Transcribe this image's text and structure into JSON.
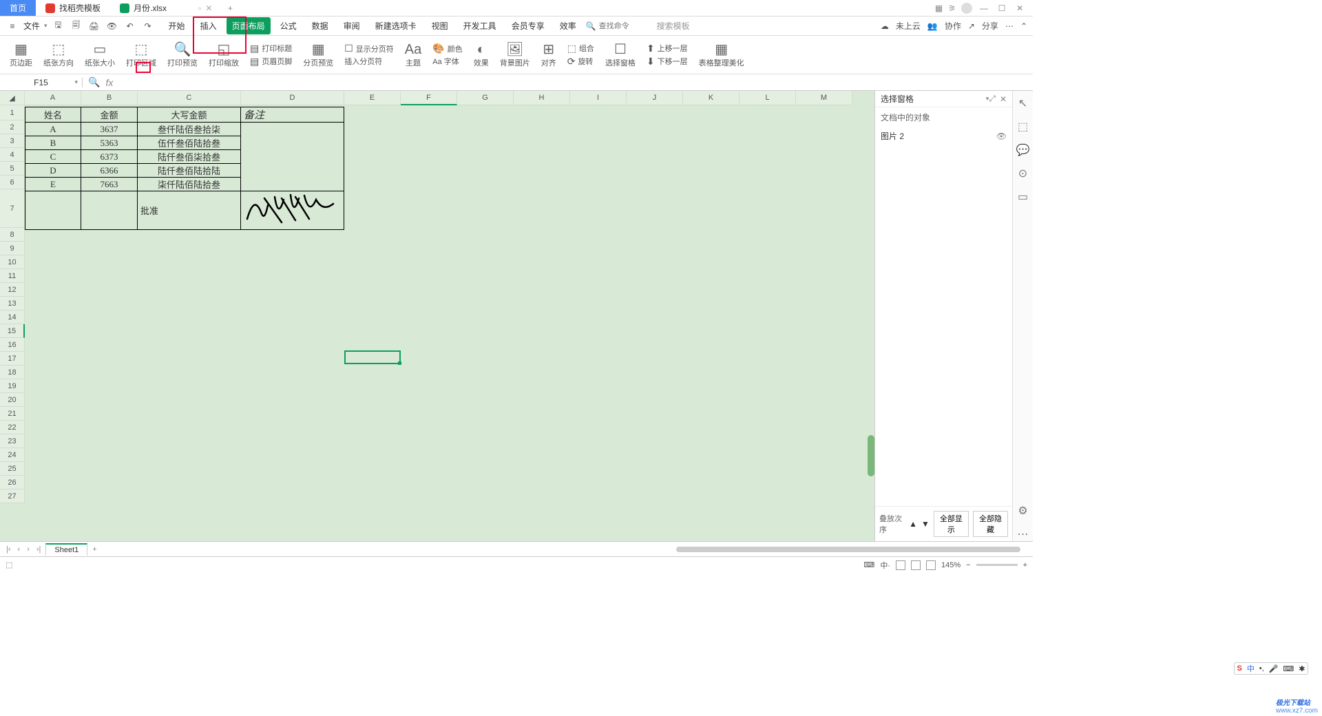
{
  "title_tabs": {
    "home": "首页",
    "templates": "找稻壳模板",
    "current_doc": "月份.xlsx",
    "plus": "+"
  },
  "window_controls": {
    "min": "—",
    "max": "☐",
    "close": "✕"
  },
  "file_menu": "文件",
  "menu": {
    "items": [
      "开始",
      "插入",
      "页面布局",
      "公式",
      "数据",
      "审阅",
      "新建选项卡",
      "视图",
      "开发工具",
      "会员专享",
      "效率"
    ],
    "active": "页面布局",
    "search_placeholder": "查找命令",
    "search_template": "搜索模板",
    "cloud": "未上云",
    "coop": "协作",
    "share": "分享"
  },
  "ribbon": {
    "margins": "页边距",
    "orientation": "纸张方向",
    "size": "纸张大小",
    "print_area": "打印区域",
    "print_preview": "打印预览",
    "print_scale": "打印缩放",
    "print_titles": "打印标题",
    "header_footer": "页眉页脚",
    "page_break_preview": "分页预览",
    "show_breaks": "显示分页符",
    "insert_break": "插入分页符",
    "theme": "主题",
    "color": "颜色",
    "font": "Aa 字体",
    "effect": "效果",
    "bg_image": "背景图片",
    "align": "对齐",
    "group": "组合",
    "rotate": "旋转",
    "sel_pane": "选择窗格",
    "up_layer": "上移一层",
    "down_layer": "下移一层",
    "table_beautify": "表格整理美化"
  },
  "name_box": "F15",
  "fx_label": "fx",
  "columns": [
    "A",
    "B",
    "C",
    "D",
    "E",
    "F",
    "G",
    "H",
    "I",
    "J",
    "K",
    "L",
    "M"
  ],
  "table": {
    "headers": [
      "姓名",
      "金额",
      "大写金额",
      "备注"
    ],
    "rows": [
      {
        "name": "A",
        "amount": "3637",
        "cn": "叁仟陆佰叁拾柒"
      },
      {
        "name": "B",
        "amount": "5363",
        "cn": "伍仟叁佰陆拾叁"
      },
      {
        "name": "C",
        "amount": "6373",
        "cn": "陆仟叁佰柒拾叁"
      },
      {
        "name": "D",
        "amount": "6366",
        "cn": "陆仟叁佰陆拾陆"
      },
      {
        "name": "E",
        "amount": "7663",
        "cn": "柒仟陆佰陆拾叁"
      }
    ],
    "approve": "批准"
  },
  "selection_pane": {
    "title": "选择窗格",
    "subtitle": "文档中的对象",
    "item": "图片 2",
    "stack": "叠放次序",
    "show_all": "全部显示",
    "hide_all": "全部隐藏"
  },
  "sheet_tab": "Sheet1",
  "status": {
    "zoom": "145%"
  },
  "ime": [
    "中",
    "•,",
    "🎤",
    "⌨",
    "✱"
  ],
  "watermark": {
    "brand": "极光下载站",
    "url": "www.xz7.com"
  }
}
